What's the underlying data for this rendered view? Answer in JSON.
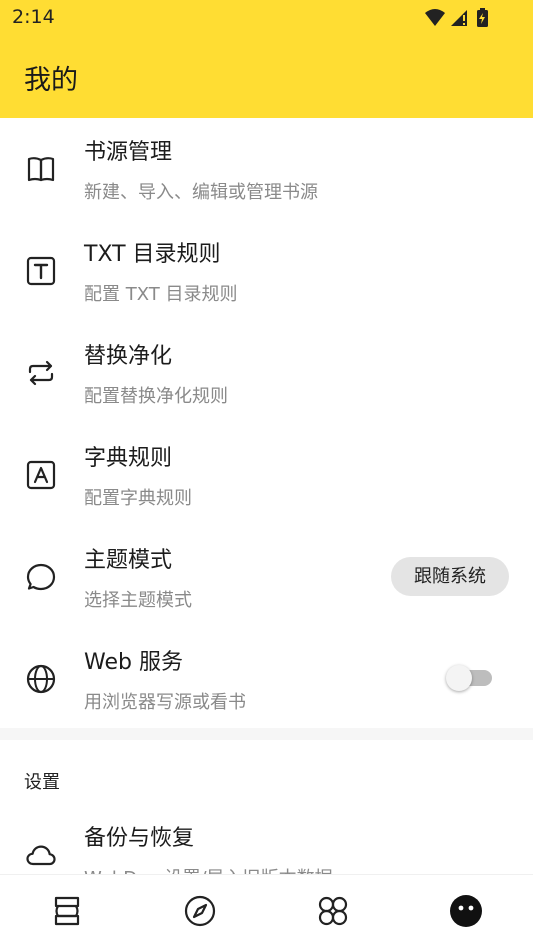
{
  "status_bar": {
    "time": "2:14"
  },
  "app": {
    "title": "我的",
    "accent": "#FFDD33"
  },
  "items": [
    {
      "title": "书源管理",
      "subtitle": "新建、导入、编辑或管理书源",
      "icon": "book-open-icon"
    },
    {
      "title": "TXT 目录规则",
      "subtitle": "配置 TXT 目录规则",
      "icon": "letter-t-icon"
    },
    {
      "title": "替换净化",
      "subtitle": "配置替换净化规则",
      "icon": "swap-arrows-icon"
    },
    {
      "title": "字典规则",
      "subtitle": "配置字典规则",
      "icon": "letter-a-icon"
    },
    {
      "title": "主题模式",
      "subtitle": "选择主题模式",
      "icon": "speech-bubble-icon",
      "value": "跟随系统"
    },
    {
      "title": "Web 服务",
      "subtitle": "用浏览器写源或看书",
      "icon": "globe-icon",
      "toggle": false
    }
  ],
  "section": {
    "label": "设置"
  },
  "settings_items": [
    {
      "title": "备份与恢复",
      "subtitle": "WebDav 设置/导入旧版本数据",
      "icon": "cloud-icon"
    }
  ],
  "bottom_nav": [
    {
      "name": "bookshelf",
      "icon": "bookshelf-icon"
    },
    {
      "name": "discover",
      "icon": "compass-icon"
    },
    {
      "name": "rss",
      "icon": "four-petal-icon"
    },
    {
      "name": "my",
      "icon": "face-icon",
      "selected": true
    }
  ]
}
